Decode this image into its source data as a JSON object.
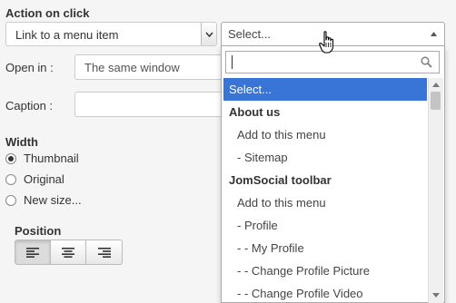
{
  "action": {
    "title": "Action on click",
    "type_value": "Link to a menu item",
    "menu_select_value": "Select..."
  },
  "open_in": {
    "label": "Open in :",
    "value": "The same window"
  },
  "caption": {
    "label": "Caption :",
    "value": ""
  },
  "width": {
    "title": "Width",
    "options": [
      {
        "label": "Thumbnail",
        "checked": true
      },
      {
        "label": "Original",
        "checked": false
      },
      {
        "label": "New size...",
        "checked": false
      }
    ]
  },
  "position": {
    "title": "Position",
    "buttons": [
      "align-left",
      "align-center",
      "align-right"
    ],
    "active": "align-left"
  },
  "dropdown": {
    "search_value": "",
    "options": [
      {
        "label": "Select...",
        "kind": "highlight"
      },
      {
        "label": "About us",
        "kind": "group"
      },
      {
        "label": "Add to this menu",
        "kind": "item"
      },
      {
        "label": "- Sitemap",
        "kind": "item"
      },
      {
        "label": "JomSocial toolbar",
        "kind": "group"
      },
      {
        "label": "Add to this menu",
        "kind": "item"
      },
      {
        "label": "- Profile",
        "kind": "item"
      },
      {
        "label": "- - My Profile",
        "kind": "item"
      },
      {
        "label": "- - Change Profile Picture",
        "kind": "item"
      },
      {
        "label": "- - Change Profile Video",
        "kind": "item"
      }
    ]
  },
  "colors": {
    "highlight": "#3875d7",
    "page_bg": "#f5f5f5"
  },
  "icons": [
    "chevron-down-icon",
    "caret-up-icon",
    "search-icon",
    "hand-cursor-icon"
  ]
}
